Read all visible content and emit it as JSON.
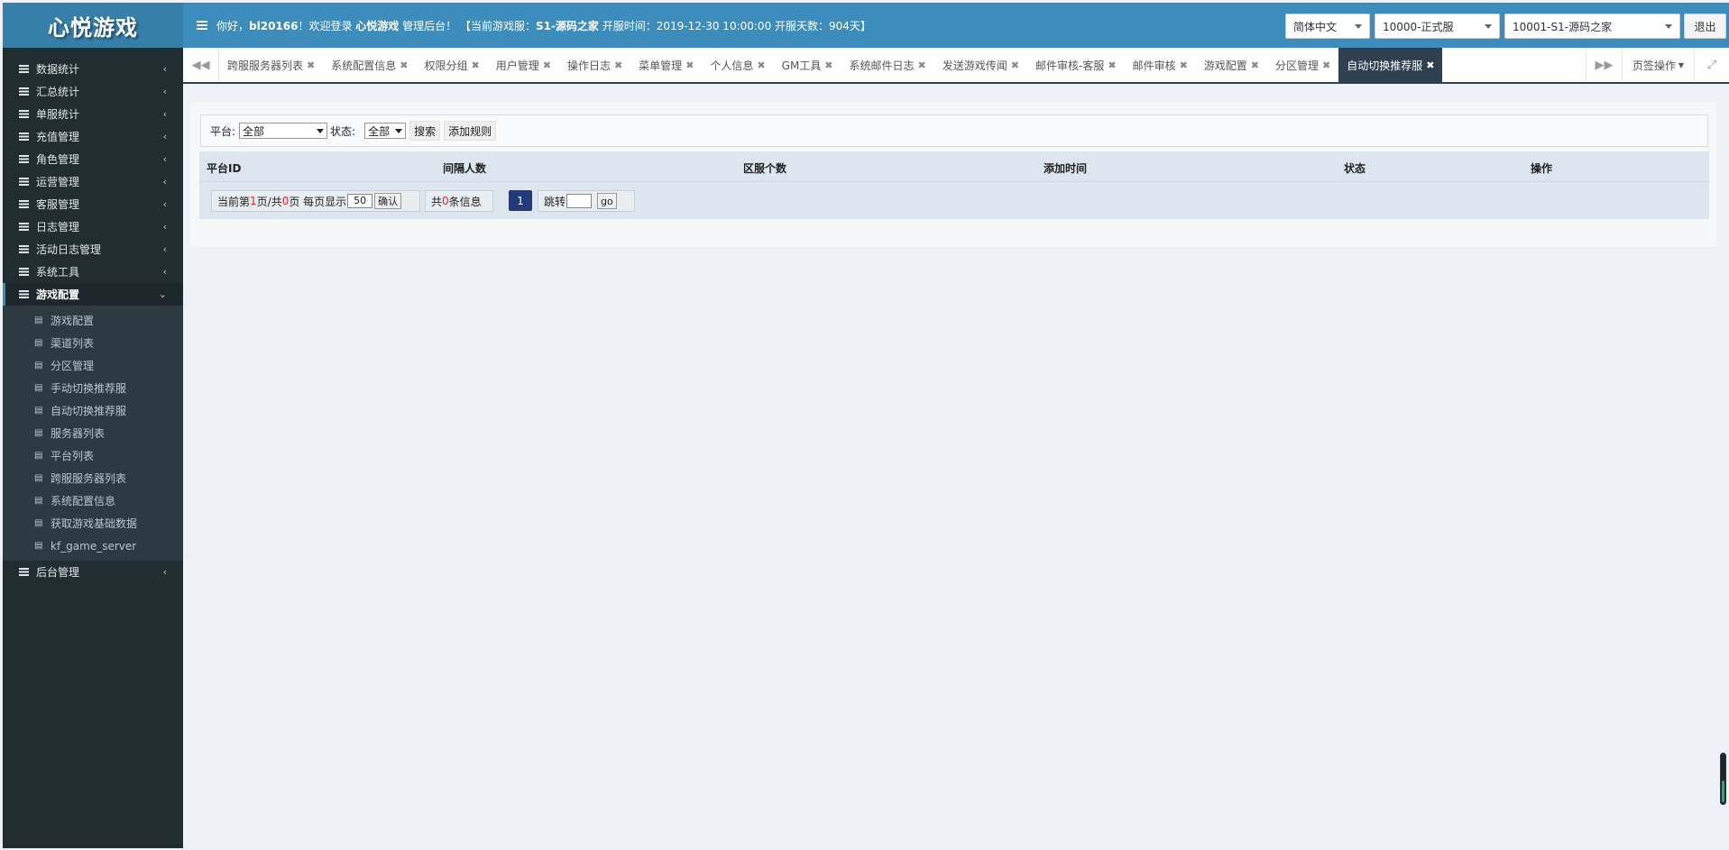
{
  "app": {
    "logo": "心悦游戏"
  },
  "sidebar": {
    "items": [
      {
        "label": "数据统计",
        "name": "sidebar-item-data-stats"
      },
      {
        "label": "汇总统计",
        "name": "sidebar-item-summary-stats"
      },
      {
        "label": "单服统计",
        "name": "sidebar-item-single-server-stats"
      },
      {
        "label": "充值管理",
        "name": "sidebar-item-recharge"
      },
      {
        "label": "角色管理",
        "name": "sidebar-item-roles"
      },
      {
        "label": "运营管理",
        "name": "sidebar-item-operations"
      },
      {
        "label": "客服管理",
        "name": "sidebar-item-customer-service"
      },
      {
        "label": "日志管理",
        "name": "sidebar-item-logs"
      },
      {
        "label": "活动日志管理",
        "name": "sidebar-item-activity-logs"
      },
      {
        "label": "系统工具",
        "name": "sidebar-item-system-tools"
      }
    ],
    "active_item": {
      "label": "游戏配置"
    },
    "sub_items": [
      {
        "label": "游戏配置"
      },
      {
        "label": "渠道列表"
      },
      {
        "label": "分区管理"
      },
      {
        "label": "手动切换推荐服"
      },
      {
        "label": "自动切换推荐服"
      },
      {
        "label": "服务器列表"
      },
      {
        "label": "平台列表"
      },
      {
        "label": "跨服服务器列表"
      },
      {
        "label": "系统配置信息"
      },
      {
        "label": "获取游戏基础数据"
      },
      {
        "label": "kf_game_server"
      }
    ],
    "last_item": {
      "label": "后台管理"
    }
  },
  "header": {
    "greet_prefix": "你好，",
    "username": "bl20166",
    "greet_mid": "！欢迎登录 ",
    "brand": "心悦游戏",
    "greet_admin": " 管理后台！  【当前游戏服：",
    "current_server": "S1-源码之家",
    "greet_open": " 开服时间：2019-12-30 10:00:00 开服天数：904天】",
    "language": "简体中文",
    "server_group": "10000-正式服",
    "server": "10001-S1-源码之家",
    "logout": "退出"
  },
  "tabs": {
    "items": [
      "跨服服务器列表",
      "系统配置信息",
      "权限分组",
      "用户管理",
      "操作日志",
      "菜单管理",
      "个人信息",
      "GM工具",
      "系统邮件日志",
      "发送游戏传闻",
      "邮件审核-客服",
      "邮件审核",
      "游戏配置",
      "分区管理",
      "自动切换推荐服"
    ],
    "active_index": 14,
    "ops_label": "页签操作"
  },
  "filter": {
    "platform_label": "平台:",
    "platform_value": "全部",
    "status_label": "状态:",
    "status_value": "全部",
    "search_button": "搜索",
    "add_button": "添加规则"
  },
  "table": {
    "columns": [
      "平台ID",
      "间隔人数",
      "区服个数",
      "添加时间",
      "状态",
      "操作"
    ]
  },
  "pager": {
    "current_prefix": "当前第",
    "current_page": "1",
    "total_mid": "页/共",
    "total_pages": "0",
    "per_page_label": "页 每页显示",
    "per_page_value": "50",
    "confirm": "确认",
    "count_prefix": "共",
    "count": "0",
    "count_suffix": "条信息",
    "page_button": "1",
    "jump_label": "跳转",
    "go": "go"
  },
  "colors": {
    "header": "#3c8dbc",
    "sidebar": "#222d32",
    "active_tab": "#2f4050",
    "page_button": "#223a7a"
  }
}
